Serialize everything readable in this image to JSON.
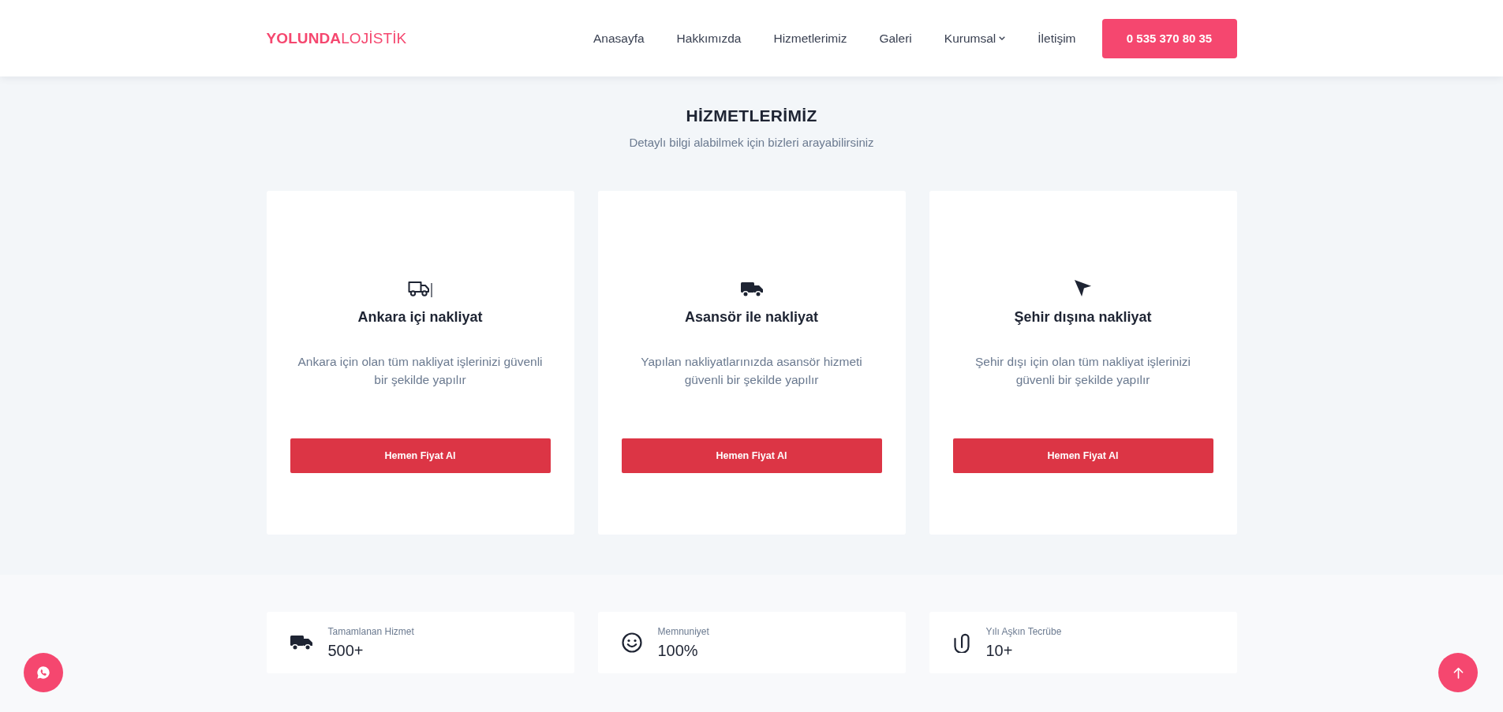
{
  "header": {
    "logo": "**YOLUNDA**LOJİSTİK",
    "nav": [
      {
        "label": "Anasayfa",
        "dropdown": false
      },
      {
        "label": "Hakkımızda",
        "dropdown": false
      },
      {
        "label": "Hizmetlerimiz",
        "dropdown": false
      },
      {
        "label": "Galeri",
        "dropdown": false
      },
      {
        "label": "Kurumsal",
        "dropdown": true
      },
      {
        "label": "İletişim",
        "dropdown": false
      }
    ],
    "phone_button": "0 535 370 80 35"
  },
  "services": {
    "title": "HİZMETLERİMİZ",
    "subtitle": "Detaylı bilgi alabilmek için bizleri arayabilirsiniz",
    "cards": [
      {
        "title": "Ankara içi nakliyat",
        "description": "Ankara için olan tüm nakliyat işlerinizi güvenli bir şekilde yapılır",
        "button": "Hemen Fiyat Al"
      },
      {
        "title": "Asansör ile nakliyat",
        "description": "Yapılan nakliyatlarınızda asansör hizmeti güvenli bir şekilde yapılır",
        "button": "Hemen Fiyat Al"
      },
      {
        "title": "Şehir dışına nakliyat",
        "description": "Şehir dışı için olan tüm nakliyat işlerinizi güvenli bir şekilde yapılır",
        "button": "Hemen Fiyat Al"
      }
    ]
  },
  "stats": [
    {
      "label": "Tamamlanan Hizmet",
      "value": "500+"
    },
    {
      "label": "Memnuniyet",
      "value": "100%"
    },
    {
      "label": "Yılı Aşkın Tecrübe",
      "value": "10+"
    }
  ]
}
